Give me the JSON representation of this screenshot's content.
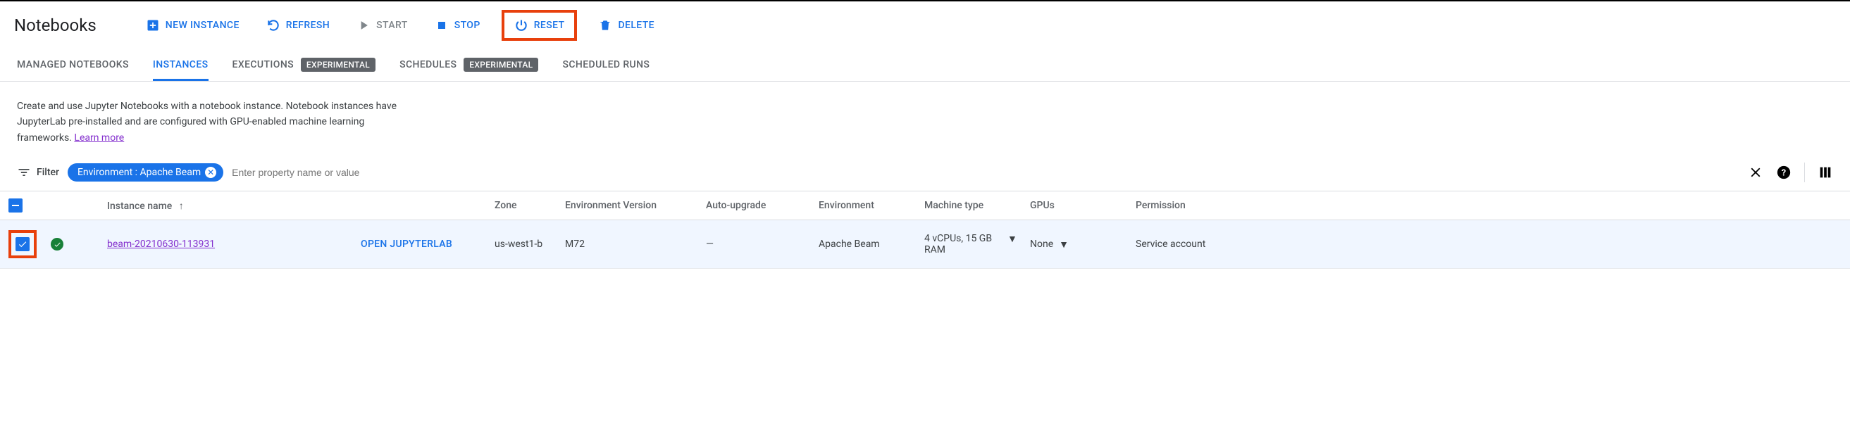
{
  "page_title": "Notebooks",
  "actions": {
    "new_instance": "NEW INSTANCE",
    "refresh": "REFRESH",
    "start": "START",
    "stop": "STOP",
    "reset": "RESET",
    "delete": "DELETE"
  },
  "tabs": {
    "managed": "MANAGED NOTEBOOKS",
    "instances": "INSTANCES",
    "executions": "EXECUTIONS",
    "schedules": "SCHEDULES",
    "scheduled_runs": "SCHEDULED RUNS",
    "experimental": "EXPERIMENTAL"
  },
  "description": "Create and use Jupyter Notebooks with a notebook instance. Notebook instances have JupyterLab pre-installed and are configured with GPU-enabled machine learning frameworks.",
  "learn_more": "Learn more",
  "filter": {
    "label": "Filter",
    "chip": "Environment : Apache Beam",
    "placeholder": "Enter property name or value"
  },
  "columns": {
    "instance_name": "Instance name",
    "zone": "Zone",
    "env_version": "Environment Version",
    "auto_upgrade": "Auto-upgrade",
    "environment": "Environment",
    "machine_type": "Machine type",
    "gpus": "GPUs",
    "permission": "Permission"
  },
  "row": {
    "name": "beam-20210630-113931",
    "open": "OPEN JUPYTERLAB",
    "zone": "us-west1-b",
    "env_version": "M72",
    "auto_upgrade": "—",
    "environment": "Apache Beam",
    "machine_type": "4 vCPUs, 15 GB RAM",
    "gpus": "None",
    "permission": "Service account"
  }
}
